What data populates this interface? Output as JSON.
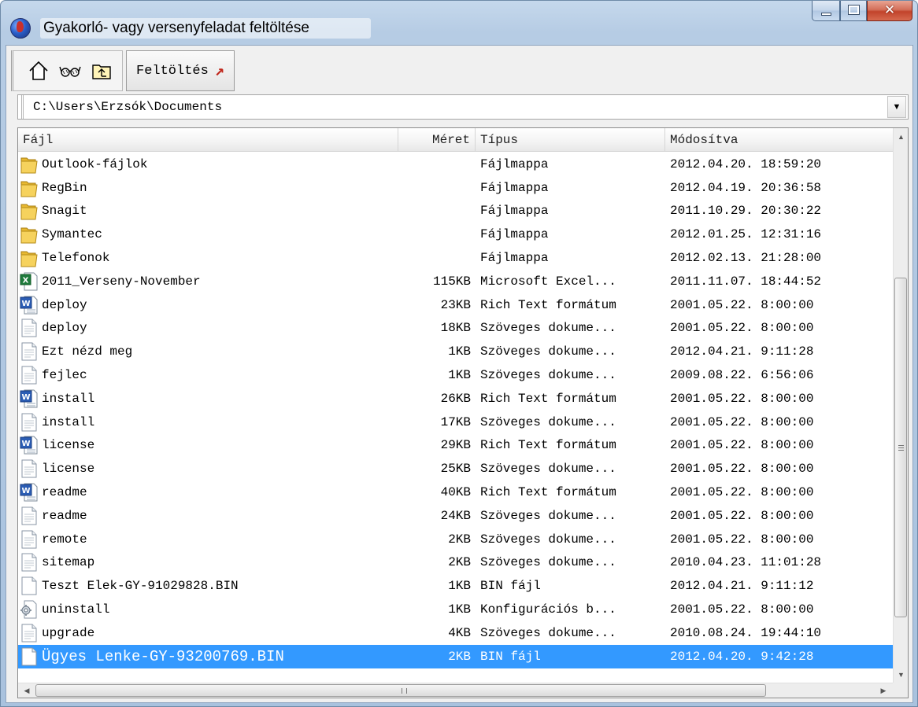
{
  "window": {
    "title": "Gyakorló- vagy versenyfeladat feltöltése"
  },
  "toolbar": {
    "icons": [
      "home-icon",
      "glasses-icon",
      "folder-up-icon"
    ],
    "upload_label": "Feltöltés"
  },
  "path": {
    "value": "C:\\Users\\Erzsók\\Documents"
  },
  "columns": {
    "name": "Fájl",
    "size": "Méret",
    "type": "Típus",
    "modified": "Módosítva"
  },
  "files": [
    {
      "icon": "folder",
      "name": "Outlook-fájlok",
      "size": "",
      "type": "Fájlmappa",
      "modified": "2012.04.20. 18:59:20"
    },
    {
      "icon": "folder",
      "name": "RegBin",
      "size": "",
      "type": "Fájlmappa",
      "modified": "2012.04.19. 20:36:58"
    },
    {
      "icon": "folder",
      "name": "Snagit",
      "size": "",
      "type": "Fájlmappa",
      "modified": "2011.10.29. 20:30:22"
    },
    {
      "icon": "folder",
      "name": "Symantec",
      "size": "",
      "type": "Fájlmappa",
      "modified": "2012.01.25. 12:31:16"
    },
    {
      "icon": "folder",
      "name": "Telefonok",
      "size": "",
      "type": "Fájlmappa",
      "modified": "2012.02.13. 21:28:00"
    },
    {
      "icon": "excel",
      "name": "2011_Verseny-November",
      "size": "115KB",
      "type": "Microsoft Excel...",
      "modified": "2011.11.07. 18:44:52"
    },
    {
      "icon": "word",
      "name": "deploy",
      "size": "23KB",
      "type": "Rich Text formátum",
      "modified": "2001.05.22. 8:00:00"
    },
    {
      "icon": "text",
      "name": "deploy",
      "size": "18KB",
      "type": "Szöveges dokume...",
      "modified": "2001.05.22. 8:00:00"
    },
    {
      "icon": "text",
      "name": "Ezt nézd meg",
      "size": "1KB",
      "type": "Szöveges dokume...",
      "modified": "2012.04.21. 9:11:28"
    },
    {
      "icon": "text",
      "name": "fejlec",
      "size": "1KB",
      "type": "Szöveges dokume...",
      "modified": "2009.08.22. 6:56:06"
    },
    {
      "icon": "word",
      "name": "install",
      "size": "26KB",
      "type": "Rich Text formátum",
      "modified": "2001.05.22. 8:00:00"
    },
    {
      "icon": "text",
      "name": "install",
      "size": "17KB",
      "type": "Szöveges dokume...",
      "modified": "2001.05.22. 8:00:00"
    },
    {
      "icon": "word",
      "name": "license",
      "size": "29KB",
      "type": "Rich Text formátum",
      "modified": "2001.05.22. 8:00:00"
    },
    {
      "icon": "text",
      "name": "license",
      "size": "25KB",
      "type": "Szöveges dokume...",
      "modified": "2001.05.22. 8:00:00"
    },
    {
      "icon": "word",
      "name": "readme",
      "size": "40KB",
      "type": "Rich Text formátum",
      "modified": "2001.05.22. 8:00:00"
    },
    {
      "icon": "text",
      "name": "readme",
      "size": "24KB",
      "type": "Szöveges dokume...",
      "modified": "2001.05.22. 8:00:00"
    },
    {
      "icon": "text",
      "name": "remote",
      "size": "2KB",
      "type": "Szöveges dokume...",
      "modified": "2001.05.22. 8:00:00"
    },
    {
      "icon": "text",
      "name": "sitemap",
      "size": "2KB",
      "type": "Szöveges dokume...",
      "modified": "2010.04.23. 11:01:28"
    },
    {
      "icon": "blank",
      "name": "Teszt Elek-GY-91029828.BIN",
      "size": "1KB",
      "type": "BIN fájl",
      "modified": "2012.04.21. 9:11:12"
    },
    {
      "icon": "config",
      "name": "uninstall",
      "size": "1KB",
      "type": "Konfigurációs b...",
      "modified": "2001.05.22. 8:00:00"
    },
    {
      "icon": "text",
      "name": "upgrade",
      "size": "4KB",
      "type": "Szöveges dokume...",
      "modified": "2010.08.24. 19:44:10"
    },
    {
      "icon": "blank",
      "name": "Ügyes Lenke-GY-93200769.BIN",
      "size": "2KB",
      "type": "BIN fájl",
      "modified": "2012.04.20. 9:42:28",
      "selected": true
    }
  ],
  "colors": {
    "selection": "#3399ff",
    "selected_text": "#ffffff"
  }
}
